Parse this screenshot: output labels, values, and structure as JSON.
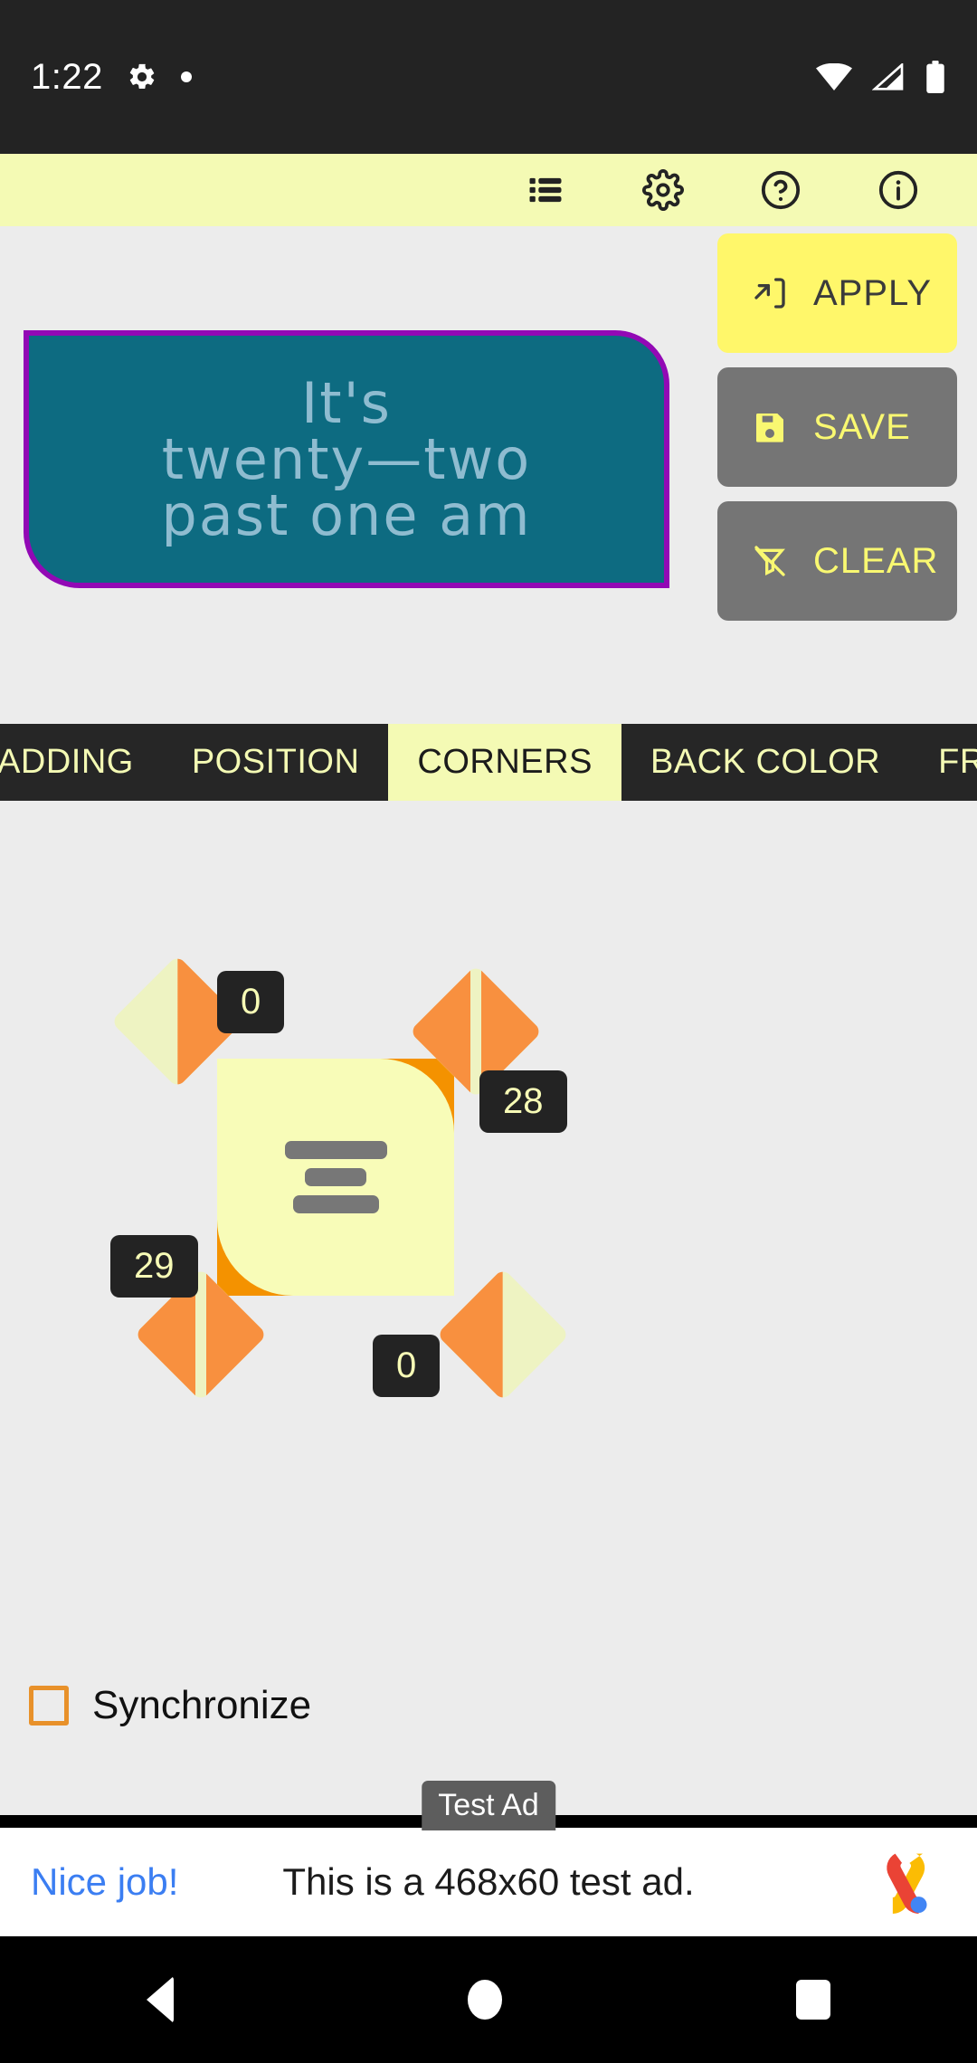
{
  "statusbar": {
    "time": "1:22",
    "icons": [
      "gear-icon",
      "dot-indicator",
      "wifi-icon",
      "cellular-signal-icon",
      "battery-icon"
    ]
  },
  "toolbar": {
    "buttons": [
      {
        "name": "list-icon",
        "label": "List"
      },
      {
        "name": "gear-icon",
        "label": "Settings"
      },
      {
        "name": "help-circle-icon",
        "label": "Help"
      },
      {
        "name": "info-circle-icon",
        "label": "Info"
      }
    ]
  },
  "preview": {
    "widget_text": "It's\ntwenty—two\npast one am",
    "background_color": "#0d6b81",
    "border_color": "#9209b5",
    "text_color": "#8fbcd0"
  },
  "actions": [
    {
      "label": "APPLY",
      "icon": "apply-to-widget-icon",
      "style": "primary"
    },
    {
      "label": "SAVE",
      "icon": "floppy-disk-icon",
      "style": "secondary"
    },
    {
      "label": "CLEAR",
      "icon": "filter-off-icon",
      "style": "secondary"
    }
  ],
  "tabs": {
    "items": [
      {
        "label": "PADDING",
        "active": false,
        "truncated": "start"
      },
      {
        "label": "POSITION",
        "active": false
      },
      {
        "label": "CORNERS",
        "active": true
      },
      {
        "label": "BACK COLOR",
        "active": false
      },
      {
        "label": "FRAME",
        "active": false,
        "truncated": "end"
      }
    ],
    "active_label": "CORNERS",
    "active_bg": "#f4fab4"
  },
  "corners": {
    "top_left": "0",
    "top_right": "28",
    "bottom_left": "29",
    "bottom_right": "0",
    "handle_color": "#eef3c2",
    "fill_color": "#f8903f",
    "card_color": "#f8fcb8",
    "card_shadow_color": "#f49200"
  },
  "synchronize": {
    "label": "Synchronize",
    "checked": false,
    "accent_color": "#e8912a"
  },
  "ad": {
    "badge": "Test Ad",
    "cta": "Nice job!",
    "text": "This is a 468x60 test ad.",
    "logo": "admob-logo"
  },
  "navbar": {
    "back": "back-button",
    "home": "home-button",
    "recents": "recents-button"
  }
}
